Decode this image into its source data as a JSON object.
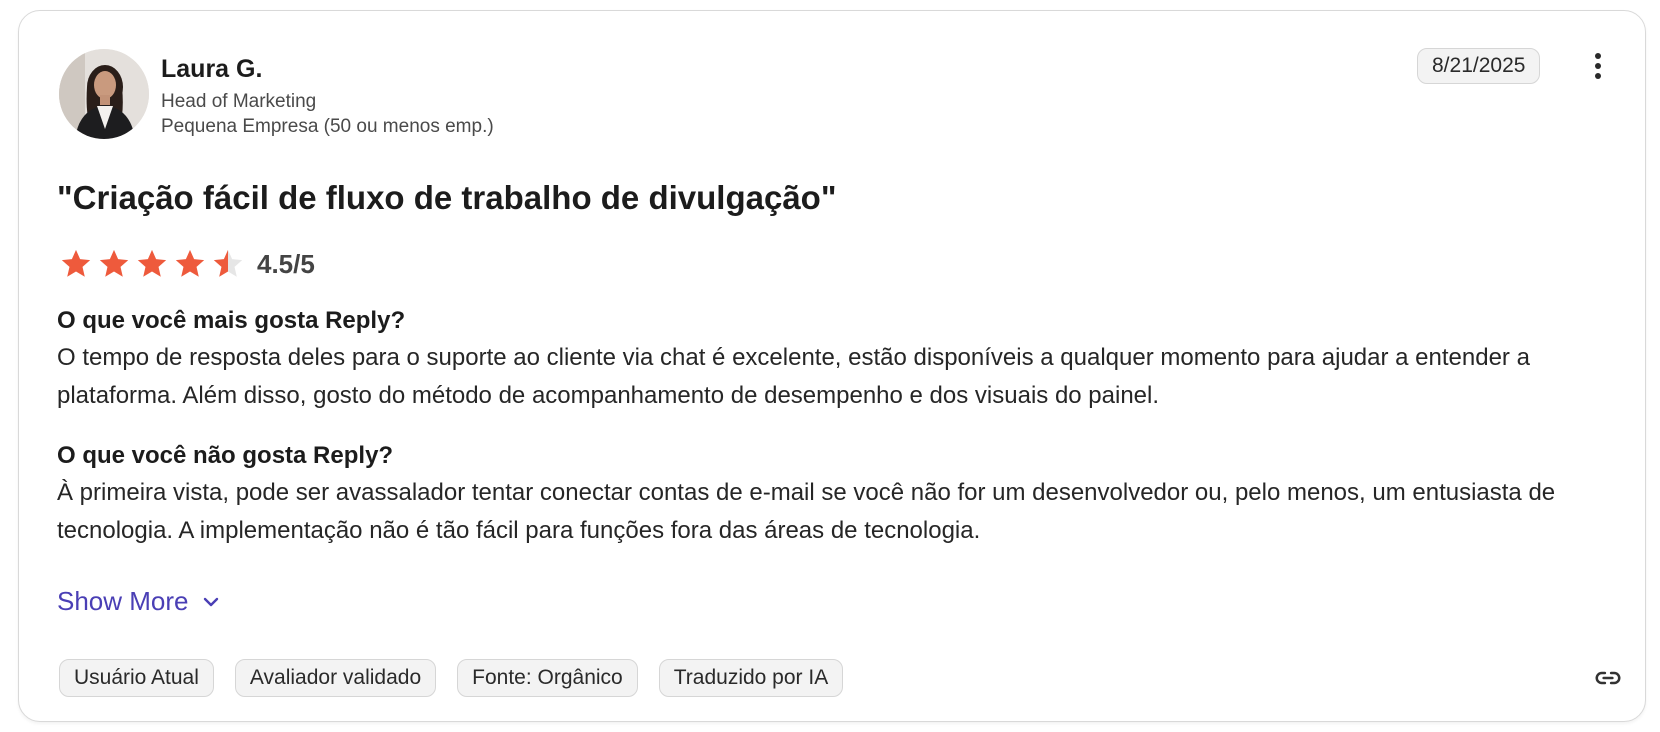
{
  "reviewer": {
    "name": "Laura G.",
    "role": "Head of Marketing",
    "company": "Pequena Empresa (50 ou menos emp.)"
  },
  "date": "8/21/2025",
  "review": {
    "title": "\"Criação fácil de fluxo de trabalho de divulgação\"",
    "rating": 4.5,
    "rating_text": "4.5/5",
    "question_like": "O que você mais gosta Reply?",
    "answer_like": "O tempo de resposta deles para o suporte ao cliente via chat é excelente, estão disponíveis a qualquer momento para ajudar a entender a plataforma. Além disso, gosto do método de acompanhamento de desempenho e dos visuais do painel.",
    "question_dislike": "O que você não gosta Reply?",
    "answer_dislike": "À primeira vista, pode ser avassalador tentar conectar contas de e-mail se você não for um desenvolvedor ou, pelo menos, um entusiasta de tecnologia. A implementação não é tão fácil para funções fora das áreas de tecnologia."
  },
  "show_more_label": "Show More",
  "tags": [
    "Usuário Atual",
    "Avaliador validado",
    "Fonte: Orgânico",
    "Traduzido por IA"
  ],
  "icons": {
    "menu": "more-vertical-icon",
    "expand": "chevron-down-icon",
    "link": "link-icon",
    "star": "star-icon"
  },
  "colors": {
    "star": "#ee5a3c",
    "star_empty": "#e6e6e6",
    "link": "#4a3fb5"
  }
}
